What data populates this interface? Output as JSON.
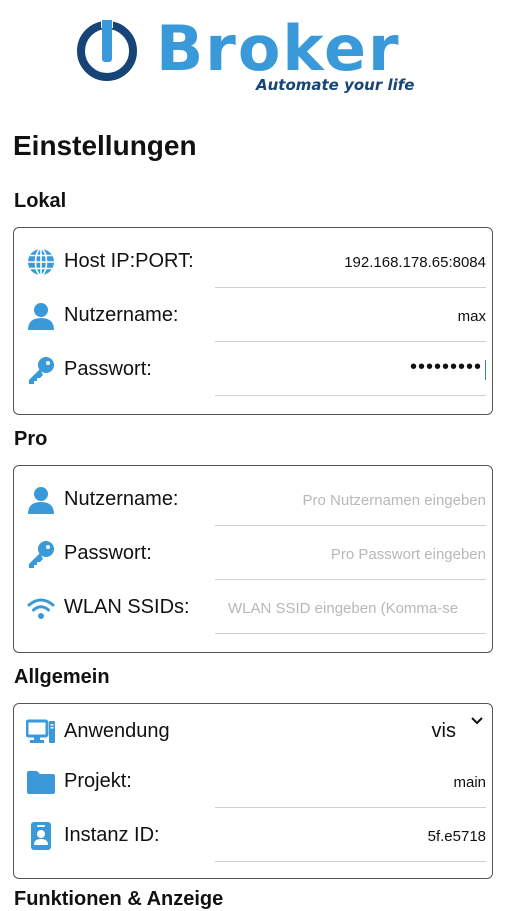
{
  "logo": {
    "brand": "Broker",
    "tagline": "Automate your life"
  },
  "page_title": "Einstellungen",
  "colors": {
    "accent": "#3a9ad9",
    "brand_dark": "#164477"
  },
  "sections": {
    "lokal": {
      "title": "Lokal",
      "host": {
        "label": "Host IP:PORT:",
        "value": "192.168.178.65:8084",
        "icon": "globe-icon"
      },
      "user": {
        "label": "Nutzername:",
        "value": "max",
        "icon": "user-icon"
      },
      "password": {
        "label": "Passwort:",
        "value": "•••••••••",
        "icon": "key-icon"
      }
    },
    "pro": {
      "title": "Pro",
      "user": {
        "label": "Nutzername:",
        "placeholder": "Pro Nutzernamen eingeben",
        "icon": "user-icon"
      },
      "password": {
        "label": "Passwort:",
        "placeholder": "Pro Passwort eingeben",
        "icon": "key-icon"
      },
      "wlan": {
        "label": "WLAN SSIDs:",
        "placeholder": "WLAN SSID eingeben (Komma-se",
        "icon": "wifi-icon"
      }
    },
    "allgemein": {
      "title": "Allgemein",
      "app": {
        "label": "Anwendung",
        "value": "vis",
        "icon": "desktop-icon"
      },
      "project": {
        "label": "Projekt:",
        "value": "main",
        "icon": "folder-icon"
      },
      "instance": {
        "label": "Instanz ID:",
        "value": "5f.e5718",
        "icon": "id-badge-icon"
      }
    }
  },
  "next_section_title": "Funktionen & Anzeige"
}
